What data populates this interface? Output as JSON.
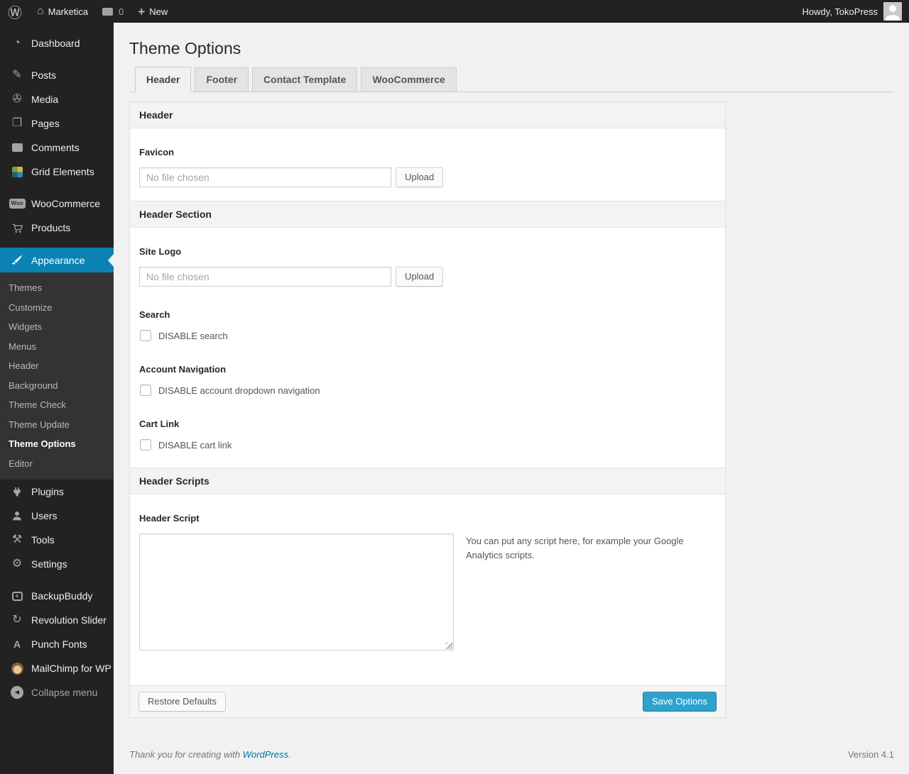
{
  "colors": {
    "accent": "#0c82b4",
    "primary_button": "#2ea2cc",
    "link": "#0074a2",
    "sidebar_bg": "#222222",
    "submenu_bg": "#333333"
  },
  "admin_bar": {
    "site_name": "Marketica",
    "comments_count": "0",
    "new_label": "New",
    "howdy": "Howdy, TokoPress"
  },
  "sidebar": {
    "top_items": [
      {
        "label": "Dashboard",
        "icon": "dashboard-icon"
      },
      {
        "label": "Posts",
        "icon": "pushpin-icon"
      },
      {
        "label": "Media",
        "icon": "media-icon"
      },
      {
        "label": "Pages",
        "icon": "pages-icon"
      },
      {
        "label": "Comments",
        "icon": "comment-bubble-icon"
      },
      {
        "label": "Grid Elements",
        "icon": "grid-icon"
      }
    ],
    "commerce_items": [
      {
        "label": "WooCommerce",
        "icon": "woocommerce-badge-icon",
        "icon_text": "Woo"
      },
      {
        "label": "Products",
        "icon": "cart-icon"
      }
    ],
    "appearance": {
      "label": "Appearance",
      "icon": "brush-icon",
      "submenu": [
        "Themes",
        "Customize",
        "Widgets",
        "Menus",
        "Header",
        "Background",
        "Theme Check",
        "Theme Update",
        "Theme Options",
        "Editor"
      ],
      "current_item": "Theme Options"
    },
    "lower_items": [
      {
        "label": "Plugins",
        "icon": "plug-icon"
      },
      {
        "label": "Users",
        "icon": "user-icon"
      },
      {
        "label": "Tools",
        "icon": "tools-icon"
      },
      {
        "label": "Settings",
        "icon": "settings-icon"
      }
    ],
    "plugin_items": [
      {
        "label": "BackupBuddy",
        "icon": "backup-drive-icon"
      },
      {
        "label": "Revolution Slider",
        "icon": "refresh-arrows-icon"
      },
      {
        "label": "Punch Fonts",
        "icon": "letter-a-icon"
      },
      {
        "label": "MailChimp for WP",
        "icon": "monkey-icon"
      }
    ],
    "collapse_label": "Collapse menu"
  },
  "page": {
    "title": "Theme Options",
    "tabs": [
      {
        "label": "Header",
        "active": true
      },
      {
        "label": "Footer",
        "active": false
      },
      {
        "label": "Contact Template",
        "active": false
      },
      {
        "label": "WooCommerce",
        "active": false
      }
    ]
  },
  "panel": {
    "sections": [
      {
        "title": "Header"
      },
      {
        "title": "Header Section"
      },
      {
        "title": "Header Scripts"
      }
    ],
    "fields": {
      "favicon": {
        "label": "Favicon",
        "file_value": "No file chosen",
        "button_label": "Upload"
      },
      "site_logo": {
        "label": "Site Logo",
        "file_value": "No file chosen",
        "button_label": "Upload"
      },
      "search": {
        "label": "Search",
        "checkbox_label": "DISABLE search",
        "checked": false
      },
      "account_navigation": {
        "label": "Account Navigation",
        "checkbox_label": "DISABLE account dropdown navigation",
        "checked": false
      },
      "cart_link": {
        "label": "Cart Link",
        "checkbox_label": "DISABLE cart link",
        "checked": false
      },
      "header_script": {
        "label": "Header Script",
        "value": "",
        "description": "You can put any script here, for example your Google Analytics scripts."
      }
    },
    "footer": {
      "restore_label": "Restore Defaults",
      "save_label": "Save Options"
    }
  },
  "page_footer": {
    "thanks_text": "Thank you for creating with",
    "wordpress_link": "WordPress",
    "period": ".",
    "version": "Version 4.1"
  }
}
